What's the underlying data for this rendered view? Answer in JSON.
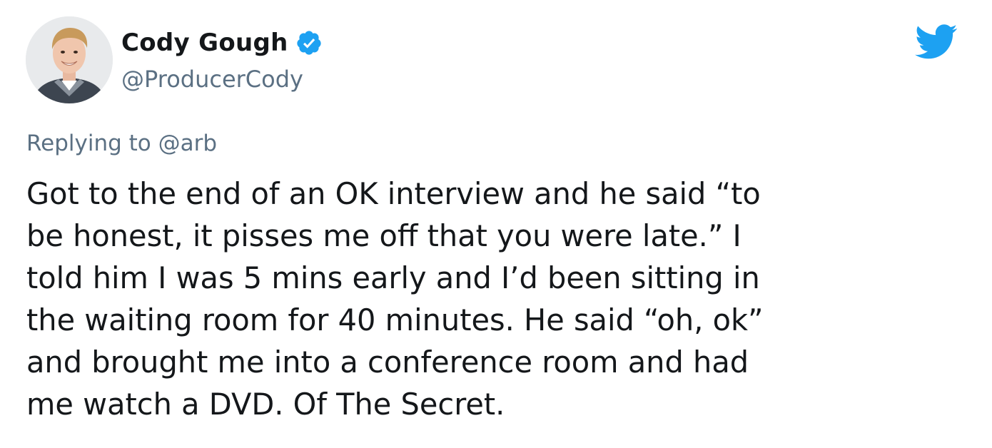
{
  "user": {
    "display_name": "Cody Gough",
    "handle": "@ProducerCody",
    "verified": true,
    "avatar_icon": "profile-photo"
  },
  "brand": {
    "logo_icon": "twitter-bird-icon",
    "color": "#1DA1F2"
  },
  "reply": {
    "prefix": "Replying to",
    "mention": "@arb"
  },
  "tweet": {
    "lines": [
      "Got to the end of an OK interview and he said “to",
      "be honest, it pisses me off that you were late.” I",
      "told him I was 5 mins early and I’d been sitting in",
      "the waiting room for 40 minutes. He said “oh, ok”",
      "and brought me into a conference room and had",
      "me watch a DVD. Of The Secret."
    ]
  },
  "colors": {
    "text": "#14171A",
    "secondary": "#5B7083",
    "verified_badge": "#1DA1F2"
  }
}
